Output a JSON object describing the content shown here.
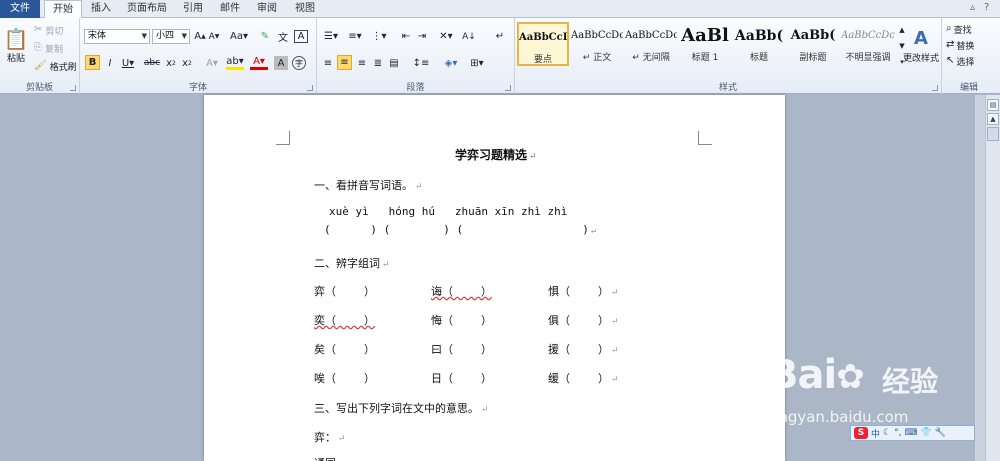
{
  "tabs": [
    {
      "label": "文件",
      "name": "tab-file"
    },
    {
      "label": "开始",
      "name": "tab-home"
    },
    {
      "label": "插入",
      "name": "tab-insert"
    },
    {
      "label": "页面布局",
      "name": "tab-page-layout"
    },
    {
      "label": "引用",
      "name": "tab-references"
    },
    {
      "label": "邮件",
      "name": "tab-mailings"
    },
    {
      "label": "审阅",
      "name": "tab-review"
    },
    {
      "label": "视图",
      "name": "tab-view"
    }
  ],
  "clipboard": {
    "paste": "粘贴",
    "cut": "剪切",
    "copy": "复制",
    "format_painter": "格式刷",
    "label": "剪贴板"
  },
  "font": {
    "name": "宋体",
    "size": "小四",
    "label": "字体"
  },
  "paragraph": {
    "label": "段落"
  },
  "styles": {
    "label": "样式",
    "items": [
      {
        "preview": "AaBbCcD",
        "name": "要点",
        "selected": true
      },
      {
        "preview": "AaBbCcDc",
        "name": "↵ 正文"
      },
      {
        "preview": "AaBbCcDc",
        "name": "↵ 无间隔"
      },
      {
        "preview": "AaBl",
        "name": "标题 1"
      },
      {
        "preview": "AaBb(",
        "name": "标题"
      },
      {
        "preview": "AaBb(",
        "name": "副标题"
      },
      {
        "preview": "AaBbCcDc",
        "name": "不明显强调"
      }
    ],
    "change_styles": "更改样式"
  },
  "editing": {
    "find": "查找",
    "replace": "替换",
    "select": "选择",
    "label": "编辑"
  },
  "document": {
    "title": "学弈习题精选",
    "s1": "一、看拼音写词语。",
    "pinyin": "xuè yì   hóng hú   zhuān xīn zhì zhì",
    "brackets": "(      ) (        ) (                  )",
    "s2": "二、辨字组词",
    "grid": [
      [
        "弈（        ）",
        "诲（        ）",
        "惧（        ）"
      ],
      [
        "奕（        ）",
        "悔（        ）",
        "俱（        ）"
      ],
      [
        "矣（        ）",
        "曰（        ）",
        "援（        ）"
      ],
      [
        "唉（        ）",
        "日（        ）",
        "缓（        ）"
      ]
    ],
    "s3": "三、写出下列字词在文中的意思。",
    "line_yi": "弈：",
    "line_tonghu": "通国"
  },
  "watermark": {
    "brand": "Bai",
    "brand2": "经验",
    "url": "jingyan.baidu.com"
  },
  "ime": {
    "logo": "S",
    "label": "中"
  }
}
